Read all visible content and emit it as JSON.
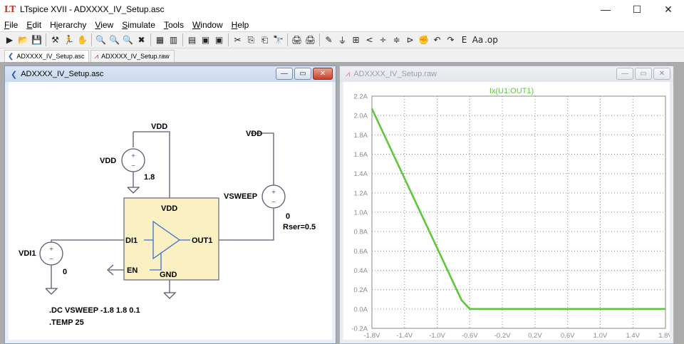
{
  "window": {
    "title": "LTspice XVII - ADXXXX_IV_Setup.asc",
    "icon": "ltspice-logo-icon",
    "logo_text": "LT",
    "minimize_glyph": "—",
    "maximize_glyph": "☐",
    "close_glyph": "✕"
  },
  "menu": [
    {
      "pre": "",
      "ul": "F",
      "post": "ile"
    },
    {
      "pre": "",
      "ul": "E",
      "post": "dit"
    },
    {
      "pre": "H",
      "ul": "i",
      "post": "erarchy"
    },
    {
      "pre": "",
      "ul": "V",
      "post": "iew"
    },
    {
      "pre": "",
      "ul": "S",
      "post": "imulate"
    },
    {
      "pre": "",
      "ul": "T",
      "post": "ools"
    },
    {
      "pre": "",
      "ul": "W",
      "post": "indow"
    },
    {
      "pre": "",
      "ul": "H",
      "post": "elp"
    }
  ],
  "toolbar": {
    "groups": [
      [
        "▶",
        "📂",
        "💾"
      ],
      [
        "⚒",
        "🏃",
        "✋"
      ],
      [
        "🔍",
        "🔍",
        "🔍",
        "✖"
      ],
      [
        "▦",
        "▥"
      ],
      [
        "▤",
        "▣",
        "▣"
      ],
      [
        "✂",
        "⎘",
        "⎗",
        "🔭"
      ],
      [
        "🖨",
        "🖨"
      ],
      [
        "✎",
        "⏚",
        "⊞",
        "<",
        "÷",
        "≑",
        "⊳",
        "✊",
        "↶",
        "↷",
        "E",
        "Aa",
        ".op"
      ]
    ]
  },
  "doc_tabs": [
    {
      "label": "ADXXXX_IV_Setup.asc",
      "icon": "schematic-icon",
      "glyph": "❮",
      "active": true
    },
    {
      "label": "ADXXXX_IV_Setup.raw",
      "icon": "waveform-icon",
      "glyph": "⩘",
      "active": false
    }
  ],
  "schematic_window": {
    "title": "ADXXXX_IV_Setup.asc",
    "btn_min": "—",
    "btn_max": "▭",
    "btn_close": "✕",
    "labels": {
      "vdd_top": "VDD",
      "vdd_source": "VDD",
      "v18": "1.8",
      "vdd_right": "VDD",
      "vsweep": "VSWEEP",
      "vsweep_val": "0",
      "rser": "Rser=0.5",
      "vdi1": "VDI1",
      "vdi1_val": "0",
      "chip_vdd": "VDD",
      "chip_di1": "DI1",
      "chip_out1": "OUT1",
      "chip_en": "EN",
      "chip_gnd": "GND",
      "dc_cmd": ".DC VSWEEP -1.8 1.8 0.1",
      "temp_cmd": ".TEMP 25"
    },
    "colors": {
      "wire": "#5a5a6e",
      "chip_fill": "#faf0c2",
      "chip_border": "#6e6e78",
      "amp": "#3a6fd8"
    }
  },
  "plot_window": {
    "title": "ADXXXX_IV_Setup.raw",
    "btn_min": "—",
    "btn_max": "▭",
    "btn_close": "✕",
    "trace_label": "Ix(U1:OUT1)",
    "trace_color": "#5cc83a",
    "y_ticks": [
      "2.2A",
      "2.0A",
      "1.8A",
      "1.6A",
      "1.4A",
      "1.2A",
      "1.0A",
      "0.8A",
      "0.6A",
      "0.4A",
      "0.2A",
      "0.0A",
      "-0.2A"
    ],
    "x_ticks": [
      "-1.8V",
      "-1.4V",
      "-1.0V",
      "-0.6V",
      "-0.2V",
      "0.2V",
      "0.6V",
      "1.0V",
      "1.4V",
      "1.8V"
    ]
  },
  "chart_data": {
    "type": "line",
    "title": "Ix(U1:OUT1)",
    "xlabel": "",
    "ylabel": "",
    "xlim": [
      -1.8,
      1.8
    ],
    "ylim": [
      -0.2,
      2.2
    ],
    "grid": true,
    "series": [
      {
        "name": "Ix(U1:OUT1)",
        "x": [
          -1.8,
          -1.7,
          -1.6,
          -1.5,
          -1.4,
          -1.3,
          -1.2,
          -1.1,
          -1.0,
          -0.9,
          -0.8,
          -0.7,
          -0.6,
          -0.5,
          -0.2,
          0.2,
          0.6,
          1.0,
          1.4,
          1.8
        ],
        "y": [
          2.07,
          1.89,
          1.71,
          1.53,
          1.35,
          1.17,
          0.99,
          0.81,
          0.63,
          0.45,
          0.27,
          0.09,
          0.0,
          0.0,
          0.0,
          0.0,
          0.0,
          0.0,
          0.0,
          0.0
        ]
      }
    ]
  }
}
